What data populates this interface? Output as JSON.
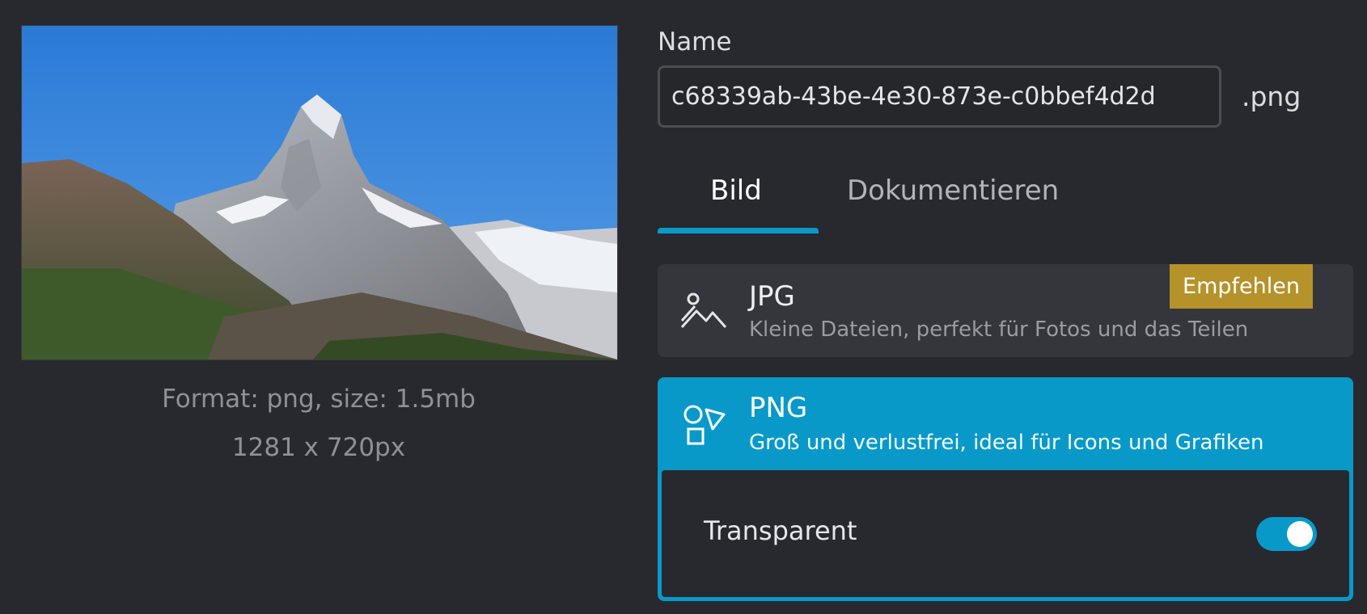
{
  "preview": {
    "format_text": "Format: png, size: 1.5mb",
    "dimensions_text": "1281 x 720px"
  },
  "name_field": {
    "label": "Name",
    "value": "c68339ab-43be-4e30-873e-c0bbef4d2d",
    "extension": ".png"
  },
  "tabs": [
    {
      "label": "Bild",
      "active": true
    },
    {
      "label": "Dokumentieren",
      "active": false
    }
  ],
  "formats": [
    {
      "title": "JPG",
      "description": "Kleine Dateien, perfekt für Fotos und das Teilen",
      "badge": "Empfehlen",
      "icon": "image-icon",
      "selected": false
    },
    {
      "title": "PNG",
      "description": "Groß und verlustfrei, ideal für Icons und Grafiken",
      "icon": "shapes-icon",
      "selected": true
    }
  ],
  "png_options": {
    "transparent_label": "Transparent",
    "transparent_enabled": true
  },
  "colors": {
    "background": "#28292e",
    "accent": "#0899c9",
    "badge": "#b5922a",
    "card": "#35363b"
  }
}
